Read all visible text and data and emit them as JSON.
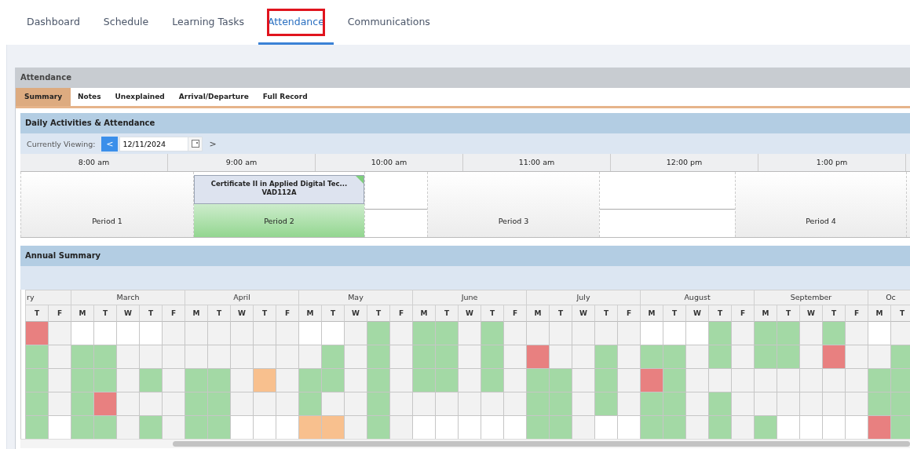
{
  "nav": {
    "tabs": [
      {
        "label": "Dashboard",
        "selected": false,
        "highlighted": false
      },
      {
        "label": "Schedule",
        "selected": false,
        "highlighted": false
      },
      {
        "label": "Learning Tasks",
        "selected": false,
        "highlighted": false
      },
      {
        "label": "Attendance",
        "selected": true,
        "highlighted": true
      },
      {
        "label": "Communications",
        "selected": false,
        "highlighted": false
      }
    ]
  },
  "panel": {
    "title": "Attendance",
    "tabs": [
      {
        "label": "Summary",
        "selected": true
      },
      {
        "label": "Notes",
        "selected": false
      },
      {
        "label": "Unexplained",
        "selected": false
      },
      {
        "label": "Arrival/Departure",
        "selected": false
      },
      {
        "label": "Full Record",
        "selected": false
      }
    ]
  },
  "daily": {
    "title": "Daily Activities & Attendance",
    "viewing_label": "Currently Viewing:",
    "prev": "<",
    "date": "12/11/2024",
    "next": ">",
    "times": [
      "8:00 am",
      "9:00 am",
      "10:00 am",
      "11:00 am",
      "12:00 pm",
      "1:00 pm"
    ],
    "slots": [
      {
        "kind": "period",
        "label": "Period 1",
        "attended": false
      },
      {
        "kind": "period",
        "label": "Period 2",
        "attended": true,
        "class": {
          "title": "Certificate II in Applied Digital Tec...",
          "code": "VAD112A"
        }
      },
      {
        "kind": "break"
      },
      {
        "kind": "period",
        "label": "Period 3",
        "attended": false
      },
      {
        "kind": "break"
      },
      {
        "kind": "period",
        "label": "Period 4",
        "attended": false
      }
    ]
  },
  "annual": {
    "title": "Annual Summary",
    "months": [
      {
        "name": "ry",
        "days": [
          {
            "label": "T",
            "cells": [
              {
                "kind": "absent"
              },
              {
                "kind": "present"
              },
              {
                "kind": "present"
              },
              {
                "kind": "present"
              },
              {
                "kind": "present"
              }
            ]
          },
          {
            "label": "F",
            "cells": [
              {
                "kind": "empty"
              },
              {
                "kind": "empty"
              },
              {
                "kind": "empty"
              },
              {
                "kind": "empty"
              },
              {
                "kind": "none"
              }
            ]
          }
        ]
      },
      {
        "name": "March",
        "days": [
          {
            "label": "M",
            "cells": [
              {
                "kind": "none"
              },
              {
                "kind": "present"
              },
              {
                "kind": "present"
              },
              {
                "kind": "present"
              },
              {
                "kind": "present"
              }
            ]
          },
          {
            "label": "T",
            "cells": [
              {
                "kind": "none"
              },
              {
                "kind": "present"
              },
              {
                "kind": "present"
              },
              {
                "kind": "absent"
              },
              {
                "kind": "present"
              }
            ]
          },
          {
            "label": "W",
            "cells": [
              {
                "kind": "none"
              },
              {
                "kind": "empty"
              },
              {
                "kind": "empty"
              },
              {
                "kind": "empty"
              },
              {
                "kind": "empty"
              }
            ]
          },
          {
            "label": "T",
            "cells": [
              {
                "kind": "none"
              },
              {
                "kind": "empty"
              },
              {
                "kind": "present"
              },
              {
                "kind": "empty"
              },
              {
                "kind": "present"
              }
            ]
          },
          {
            "label": "F",
            "cells": [
              {
                "kind": "empty"
              },
              {
                "kind": "empty"
              },
              {
                "kind": "empty"
              },
              {
                "kind": "empty"
              },
              {
                "kind": "empty"
              }
            ]
          }
        ]
      },
      {
        "name": "April",
        "days": [
          {
            "label": "M",
            "cells": [
              {
                "kind": "empty"
              },
              {
                "kind": "empty"
              },
              {
                "kind": "present"
              },
              {
                "kind": "present"
              },
              {
                "kind": "present"
              }
            ]
          },
          {
            "label": "T",
            "cells": [
              {
                "kind": "empty"
              },
              {
                "kind": "empty"
              },
              {
                "kind": "present"
              },
              {
                "kind": "present"
              },
              {
                "kind": "present"
              }
            ]
          },
          {
            "label": "W",
            "cells": [
              {
                "kind": "empty"
              },
              {
                "kind": "empty"
              },
              {
                "kind": "empty"
              },
              {
                "kind": "empty"
              },
              {
                "kind": "none"
              }
            ]
          },
          {
            "label": "T",
            "cells": [
              {
                "kind": "empty"
              },
              {
                "kind": "empty"
              },
              {
                "kind": "late"
              },
              {
                "kind": "empty"
              },
              {
                "kind": "none"
              }
            ]
          },
          {
            "label": "F",
            "cells": [
              {
                "kind": "empty"
              },
              {
                "kind": "empty"
              },
              {
                "kind": "empty"
              },
              {
                "kind": "empty"
              },
              {
                "kind": "none"
              }
            ]
          }
        ]
      },
      {
        "name": "May",
        "days": [
          {
            "label": "M",
            "cells": [
              {
                "kind": "none"
              },
              {
                "kind": "empty"
              },
              {
                "kind": "present"
              },
              {
                "kind": "present"
              },
              {
                "kind": "late"
              }
            ]
          },
          {
            "label": "T",
            "cells": [
              {
                "kind": "none"
              },
              {
                "kind": "present"
              },
              {
                "kind": "present"
              },
              {
                "kind": "empty"
              },
              {
                "kind": "late"
              }
            ]
          },
          {
            "label": "W",
            "cells": [
              {
                "kind": "empty"
              },
              {
                "kind": "empty"
              },
              {
                "kind": "empty"
              },
              {
                "kind": "empty"
              },
              {
                "kind": "empty"
              }
            ]
          },
          {
            "label": "T",
            "cells": [
              {
                "kind": "present"
              },
              {
                "kind": "present"
              },
              {
                "kind": "present"
              },
              {
                "kind": "present"
              },
              {
                "kind": "present"
              }
            ]
          },
          {
            "label": "F",
            "cells": [
              {
                "kind": "empty"
              },
              {
                "kind": "empty"
              },
              {
                "kind": "empty"
              },
              {
                "kind": "empty"
              },
              {
                "kind": "empty"
              }
            ]
          }
        ]
      },
      {
        "name": "June",
        "days": [
          {
            "label": "M",
            "cells": [
              {
                "kind": "present"
              },
              {
                "kind": "present"
              },
              {
                "kind": "present"
              },
              {
                "kind": "empty"
              },
              {
                "kind": "none"
              }
            ]
          },
          {
            "label": "T",
            "cells": [
              {
                "kind": "present"
              },
              {
                "kind": "present"
              },
              {
                "kind": "present"
              },
              {
                "kind": "empty"
              },
              {
                "kind": "none"
              }
            ]
          },
          {
            "label": "W",
            "cells": [
              {
                "kind": "empty"
              },
              {
                "kind": "empty"
              },
              {
                "kind": "empty"
              },
              {
                "kind": "empty"
              },
              {
                "kind": "none"
              }
            ]
          },
          {
            "label": "T",
            "cells": [
              {
                "kind": "present"
              },
              {
                "kind": "present"
              },
              {
                "kind": "present"
              },
              {
                "kind": "empty"
              },
              {
                "kind": "none"
              }
            ]
          },
          {
            "label": "F",
            "cells": [
              {
                "kind": "empty"
              },
              {
                "kind": "empty"
              },
              {
                "kind": "empty"
              },
              {
                "kind": "empty"
              },
              {
                "kind": "none"
              }
            ]
          }
        ]
      },
      {
        "name": "July",
        "days": [
          {
            "label": "M",
            "cells": [
              {
                "kind": "empty"
              },
              {
                "kind": "absent"
              },
              {
                "kind": "present"
              },
              {
                "kind": "present"
              },
              {
                "kind": "present"
              }
            ]
          },
          {
            "label": "T",
            "cells": [
              {
                "kind": "empty"
              },
              {
                "kind": "empty"
              },
              {
                "kind": "present"
              },
              {
                "kind": "present"
              },
              {
                "kind": "present"
              }
            ]
          },
          {
            "label": "W",
            "cells": [
              {
                "kind": "empty"
              },
              {
                "kind": "empty"
              },
              {
                "kind": "empty"
              },
              {
                "kind": "empty"
              },
              {
                "kind": "empty"
              }
            ]
          },
          {
            "label": "T",
            "cells": [
              {
                "kind": "empty"
              },
              {
                "kind": "present"
              },
              {
                "kind": "present"
              },
              {
                "kind": "present"
              },
              {
                "kind": "none"
              }
            ]
          },
          {
            "label": "F",
            "cells": [
              {
                "kind": "empty"
              },
              {
                "kind": "empty"
              },
              {
                "kind": "empty"
              },
              {
                "kind": "empty"
              },
              {
                "kind": "none"
              }
            ]
          }
        ]
      },
      {
        "name": "August",
        "days": [
          {
            "label": "M",
            "cells": [
              {
                "kind": "none"
              },
              {
                "kind": "present"
              },
              {
                "kind": "absent"
              },
              {
                "kind": "present"
              },
              {
                "kind": "present"
              }
            ]
          },
          {
            "label": "T",
            "cells": [
              {
                "kind": "none"
              },
              {
                "kind": "present"
              },
              {
                "kind": "present"
              },
              {
                "kind": "present"
              },
              {
                "kind": "present"
              }
            ]
          },
          {
            "label": "W",
            "cells": [
              {
                "kind": "none"
              },
              {
                "kind": "empty"
              },
              {
                "kind": "empty"
              },
              {
                "kind": "empty"
              },
              {
                "kind": "empty"
              }
            ]
          },
          {
            "label": "T",
            "cells": [
              {
                "kind": "present"
              },
              {
                "kind": "present"
              },
              {
                "kind": "empty"
              },
              {
                "kind": "present"
              },
              {
                "kind": "present"
              }
            ]
          },
          {
            "label": "F",
            "cells": [
              {
                "kind": "empty"
              },
              {
                "kind": "empty"
              },
              {
                "kind": "empty"
              },
              {
                "kind": "empty"
              },
              {
                "kind": "empty"
              }
            ]
          }
        ]
      },
      {
        "name": "September",
        "days": [
          {
            "label": "M",
            "cells": [
              {
                "kind": "present"
              },
              {
                "kind": "present"
              },
              {
                "kind": "empty"
              },
              {
                "kind": "empty"
              },
              {
                "kind": "present"
              }
            ]
          },
          {
            "label": "T",
            "cells": [
              {
                "kind": "present"
              },
              {
                "kind": "present"
              },
              {
                "kind": "empty"
              },
              {
                "kind": "empty"
              },
              {
                "kind": "none"
              }
            ]
          },
          {
            "label": "W",
            "cells": [
              {
                "kind": "empty"
              },
              {
                "kind": "empty"
              },
              {
                "kind": "empty"
              },
              {
                "kind": "empty"
              },
              {
                "kind": "none"
              }
            ]
          },
          {
            "label": "T",
            "cells": [
              {
                "kind": "present"
              },
              {
                "kind": "absent"
              },
              {
                "kind": "empty"
              },
              {
                "kind": "empty"
              },
              {
                "kind": "none"
              }
            ]
          },
          {
            "label": "F",
            "cells": [
              {
                "kind": "empty"
              },
              {
                "kind": "empty"
              },
              {
                "kind": "empty"
              },
              {
                "kind": "empty"
              },
              {
                "kind": "none"
              }
            ]
          }
        ]
      },
      {
        "name": "Oc",
        "days": [
          {
            "label": "M",
            "cells": [
              {
                "kind": "none"
              },
              {
                "kind": "empty"
              },
              {
                "kind": "present"
              },
              {
                "kind": "present"
              },
              {
                "kind": "absent"
              }
            ]
          },
          {
            "label": "T",
            "cells": [
              {
                "kind": "empty"
              },
              {
                "kind": "present"
              },
              {
                "kind": "present"
              },
              {
                "kind": "present"
              },
              {
                "kind": "present"
              }
            ]
          }
        ]
      }
    ]
  }
}
